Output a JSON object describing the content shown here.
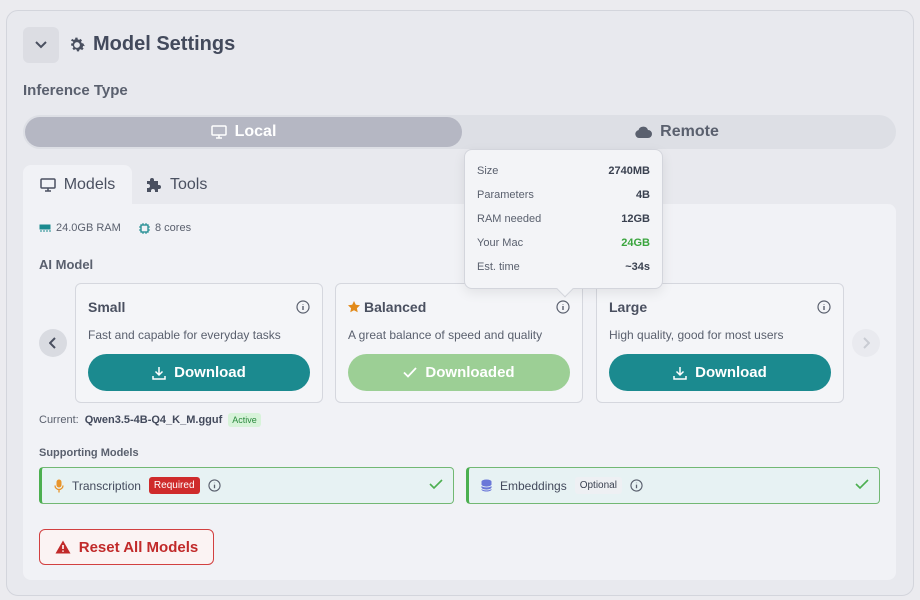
{
  "header": {
    "title": "Model Settings"
  },
  "inference": {
    "label": "Inference Type",
    "local": "Local",
    "remote": "Remote"
  },
  "tabs": {
    "models": "Models",
    "tools": "Tools"
  },
  "specs": {
    "ram": "24.0GB RAM",
    "cores": "8 cores"
  },
  "ai_model": {
    "label": "AI Model"
  },
  "cards": [
    {
      "name": "Small",
      "desc": "Fast and capable for everyday tasks",
      "button": "Download"
    },
    {
      "name": "Balanced",
      "desc": "A great balance of speed and quality",
      "button": "Downloaded"
    },
    {
      "name": "Large",
      "desc": "High quality, good for most users",
      "button": "Download"
    }
  ],
  "current": {
    "label": "Current:",
    "file": "Qwen3.5-4B-Q4_K_M.gguf",
    "status": "Active"
  },
  "supporting": {
    "label": "Supporting Models",
    "transcription": {
      "name": "Transcription",
      "badge": "Required"
    },
    "embeddings": {
      "name": "Embeddings",
      "badge": "Optional"
    }
  },
  "reset": {
    "label": "Reset All Models"
  },
  "tooltip": {
    "size_label": "Size",
    "size": "2740MB",
    "params_label": "Parameters",
    "params": "4B",
    "ram_label": "RAM needed",
    "ram": "12GB",
    "mac_label": "Your Mac",
    "mac": "24GB",
    "time_label": "Est. time",
    "time": "~34s"
  },
  "colors": {
    "accent": "#1b8a8f",
    "downloaded": "#9ccf95",
    "danger": "#cf2b2b",
    "success": "#4caf50"
  }
}
